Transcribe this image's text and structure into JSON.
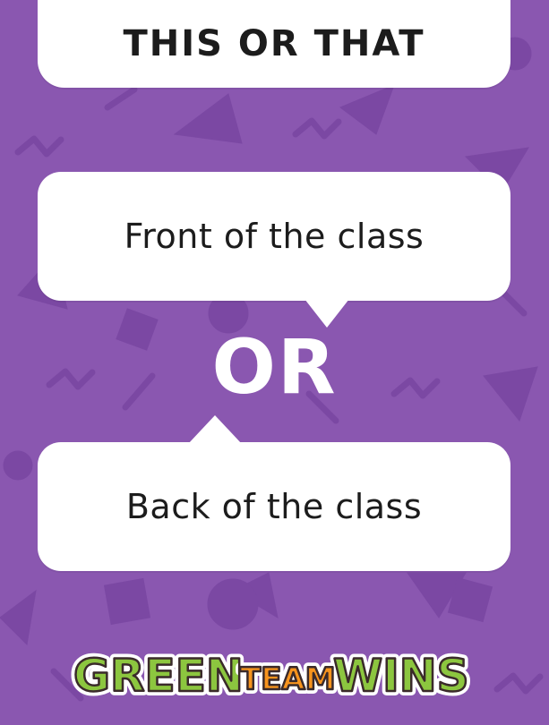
{
  "title": "THIS OR THAT",
  "options": [
    {
      "label": "Front of the class"
    },
    {
      "label": "Back of the class"
    }
  ],
  "separator": "OR",
  "logo": {
    "word1": "GREEN",
    "word2": "TEAM",
    "word3": "WINS"
  },
  "colors": {
    "background": "#8a57b0",
    "pattern": "#7b48a3",
    "card": "#ffffff",
    "text": "#1c1c1c",
    "logo_green": "#8cc63f",
    "logo_orange": "#f7941d",
    "logo_outline": "#3a2a2a"
  }
}
